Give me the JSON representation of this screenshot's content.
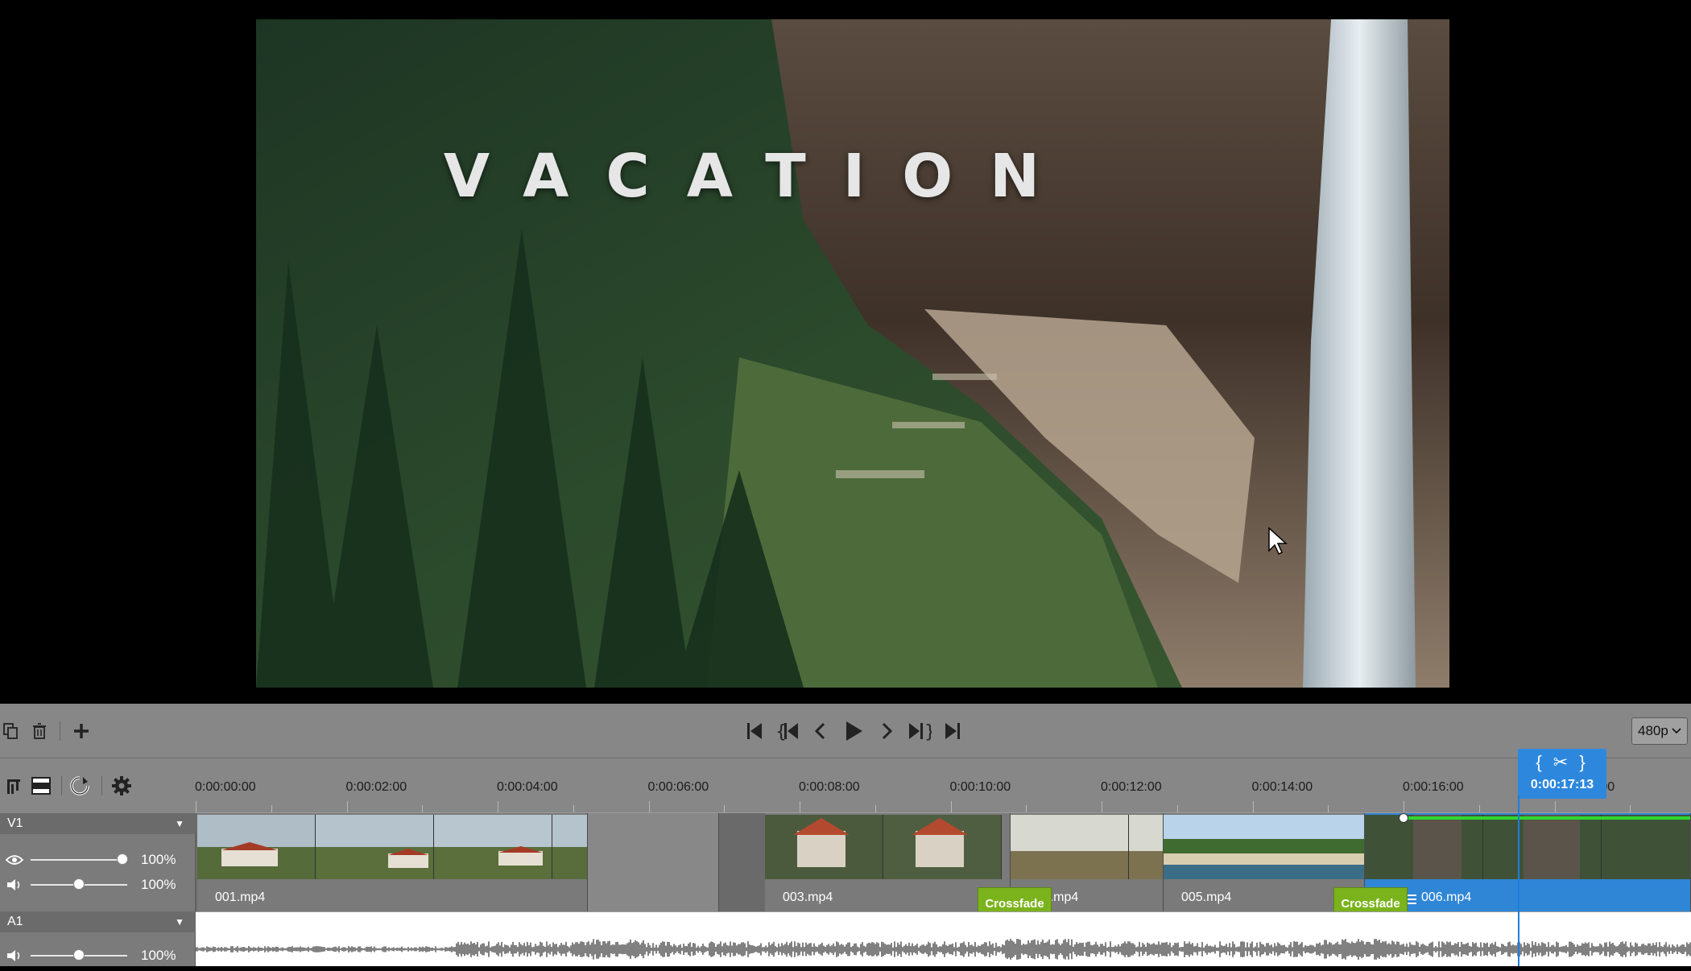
{
  "preview": {
    "title_overlay": "VACATION"
  },
  "toolbar": {
    "left_buttons": [
      "copy-icon",
      "trash-icon",
      "add-icon"
    ],
    "transport_buttons": [
      "jump-to-start-icon",
      "previous-marker-icon",
      "previous-frame-icon",
      "play-icon",
      "next-frame-icon",
      "next-marker-icon",
      "jump-to-end-icon"
    ],
    "resolution": "480p"
  },
  "timeline": {
    "ruler_labels": [
      "0:00:00:00",
      "0:00:02:00",
      "0:00:04:00",
      "0:00:06:00",
      "0:00:08:00",
      "0:00:10:00",
      "0:00:12:00",
      "0:00:14:00",
      "0:00:16:00",
      "0:00:18:00"
    ],
    "playhead_time": "0:00:17:13",
    "tracks": {
      "v1": {
        "name": "V1",
        "opacity": "100%",
        "volume": "100%"
      },
      "a1": {
        "name": "A1",
        "volume": "100%"
      }
    },
    "clips": [
      "001.mp4",
      "003.mp4",
      "004.mp4",
      "005.mp4",
      "006.mp4"
    ],
    "transitions": [
      "Crossfade",
      "Crossfade"
    ]
  },
  "colors": {
    "accent": "#2f86d6",
    "transition": "#7bb31c",
    "selection_line": "#2ed82e"
  }
}
